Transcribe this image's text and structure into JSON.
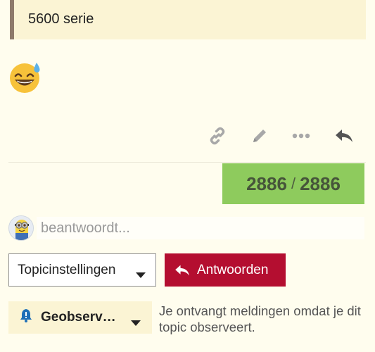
{
  "quote": {
    "text": "5600 serie"
  },
  "post": {
    "emoji": "sweat-smile-emoji"
  },
  "actions": {
    "icons": [
      "link-icon",
      "pencil-icon",
      "ellipsis-icon",
      "reply-arrow-icon"
    ]
  },
  "progress": {
    "current": "2886",
    "separator": "/",
    "total": "2886"
  },
  "composer": {
    "typing_text": "beantwoordt..."
  },
  "buttons": {
    "topic_settings": "Topicinstellingen",
    "reply": "Antwoorden"
  },
  "notifications": {
    "level": "Geobserv…",
    "reason": "Je ontvangt meldingen omdat je dit topic observeert."
  },
  "colors": {
    "background": "#fffdee",
    "quote_bg": "#fbf4d4",
    "quote_border": "#8e7a6a",
    "progress_bg": "#8ecb5d",
    "reply_bg": "#b40e30",
    "icon_gray": "#a8a8a8",
    "notif_bell": "#1f6fb7"
  }
}
